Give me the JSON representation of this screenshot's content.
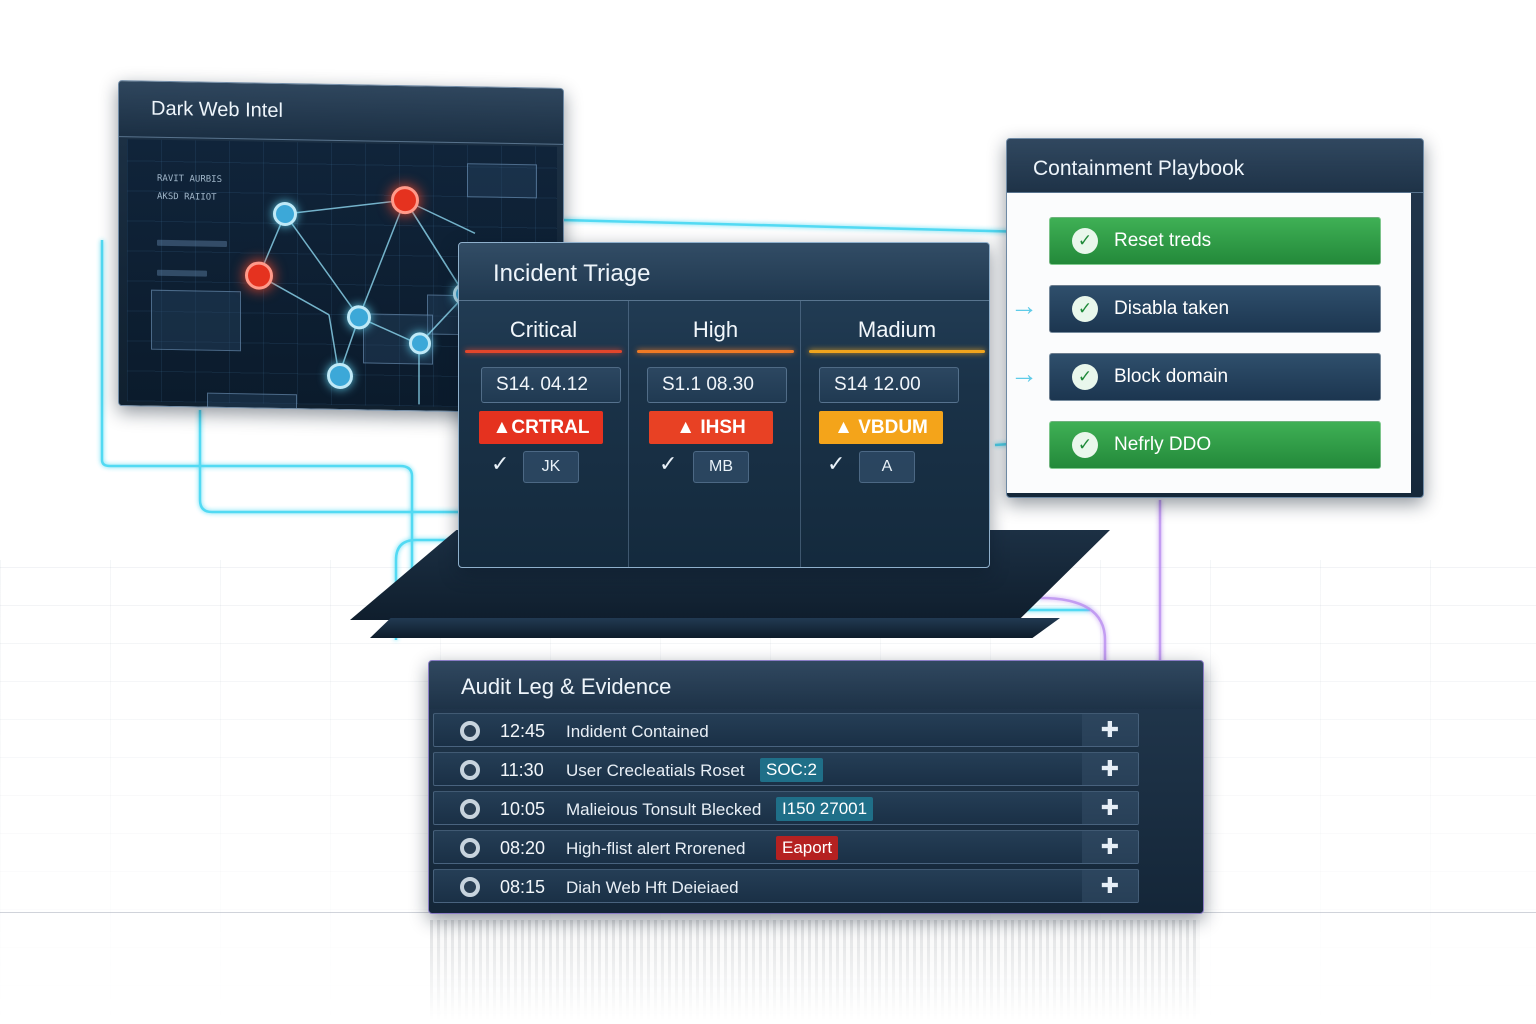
{
  "dark_web": {
    "title": "Dark Web Intel",
    "legend_line1": "RAVIT AURBIS",
    "legend_line2": "AKSD RAIIOT"
  },
  "triage": {
    "title": "Incident Triage",
    "columns": [
      {
        "heading": "Critical",
        "timestamp": "S14. 04.12",
        "badge": "▲CRTRAL",
        "badge_color": "#e5321f",
        "line_color": "#e2462c",
        "check": "✓",
        "tag": "JK"
      },
      {
        "heading": "High",
        "timestamp": "S1.1 08.30",
        "badge": "▲ IHSH",
        "badge_color": "#e84124",
        "line_color": "#f07a25",
        "check": "✓",
        "tag": "MB"
      },
      {
        "heading": "Madium",
        "timestamp": "S14 12.00",
        "badge": "▲ VBDUM",
        "badge_color": "#f4a41a",
        "line_color": "#f0a51e",
        "check": "✓",
        "tag": "A"
      }
    ]
  },
  "playbook": {
    "title": "Containment Playbook",
    "items": [
      {
        "label": "Reset treds",
        "state": "green"
      },
      {
        "label": "Disabla taken",
        "state": "blue"
      },
      {
        "label": "Block domain",
        "state": "blue"
      },
      {
        "label": "Nefrly DDO",
        "state": "green"
      }
    ]
  },
  "audit": {
    "title": "Audit Leg & Evidence",
    "rows": [
      {
        "time": "12:45",
        "text": "Indident Contained",
        "tag": "",
        "tag_color": ""
      },
      {
        "time": "11:30",
        "text": "User Crecleatials Roset",
        "tag": "SOC:2",
        "tag_color": "#1f6f88"
      },
      {
        "time": "10:05",
        "text": "Malieious Tonsult Blecked",
        "tag": "I150 27001",
        "tag_color": "#1f6f88"
      },
      {
        "time": "08:20",
        "text": "High-flist alert Rrorened",
        "tag": "Eaport",
        "tag_color": "#b52121"
      },
      {
        "time": "08:15",
        "text": "Diah Web Hft Deieiaed",
        "tag": "",
        "tag_color": ""
      }
    ]
  },
  "icons": {
    "check": "check-icon",
    "alert": "alert-triangle-icon",
    "expand": "plus-cross-icon",
    "status_ring": "status-ring-icon",
    "arrow": "arrow-right-icon"
  },
  "colors": {
    "glow_cyan": "#3fd6f2",
    "glow_violet": "#b98cf0",
    "success_green": "#2e9c45",
    "critical_red": "#e5321f",
    "medium_amber": "#f4a41a"
  }
}
